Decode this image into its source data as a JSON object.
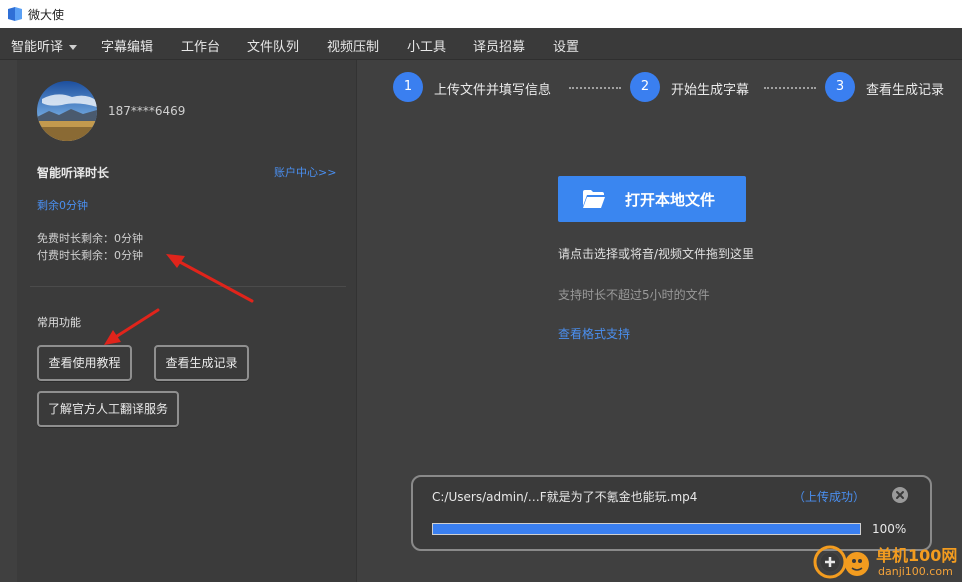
{
  "app": {
    "title": "微大使"
  },
  "menu": [
    {
      "label": "智能听译"
    },
    {
      "label": "字幕编辑"
    },
    {
      "label": "工作台"
    },
    {
      "label": "文件队列"
    },
    {
      "label": "视频压制"
    },
    {
      "label": "小工具"
    },
    {
      "label": "译员招募"
    },
    {
      "label": "设置"
    }
  ],
  "account": {
    "phone": "187****6469",
    "section_title": "智能听译时长",
    "center_link": "账户中心>>",
    "remaining": "剩余0分钟",
    "free_remaining": "免费时长剩余：0分钟",
    "paid_remaining": "付费时长剩余：0分钟"
  },
  "common": {
    "title": "常用功能",
    "tutorial": "查看使用教程",
    "records": "查看生成记录",
    "official_service": "了解官方人工翻译服务"
  },
  "steps": [
    {
      "number": "1",
      "label": "上传文件并填写信息"
    },
    {
      "number": "2",
      "label": "开始生成字幕"
    },
    {
      "number": "3",
      "label": "查看生成记录"
    }
  ],
  "main": {
    "open_button": "打开本地文件",
    "hint_drag": "请点击选择或将音/视频文件拖到这里",
    "hint_limit": "支持时长不超过5小时的文件",
    "format_link": "查看格式支持"
  },
  "upload": {
    "file_path": "C:/Users/admin/…F就是为了不氪金也能玩.mp4",
    "status": "（上传成功）",
    "progress_text": "100%",
    "progress": 1.0
  },
  "watermark": {
    "brand": "单机100网",
    "url": "danji100.com"
  },
  "colors": {
    "accent": "#3a86f0",
    "link": "#4a8ff0",
    "annotation_arrow": "#e0241b",
    "watermark": "#f39c1f"
  },
  "icons": [
    "app-logo-icon",
    "chevron-down-icon",
    "folder-open-icon",
    "close-icon"
  ]
}
